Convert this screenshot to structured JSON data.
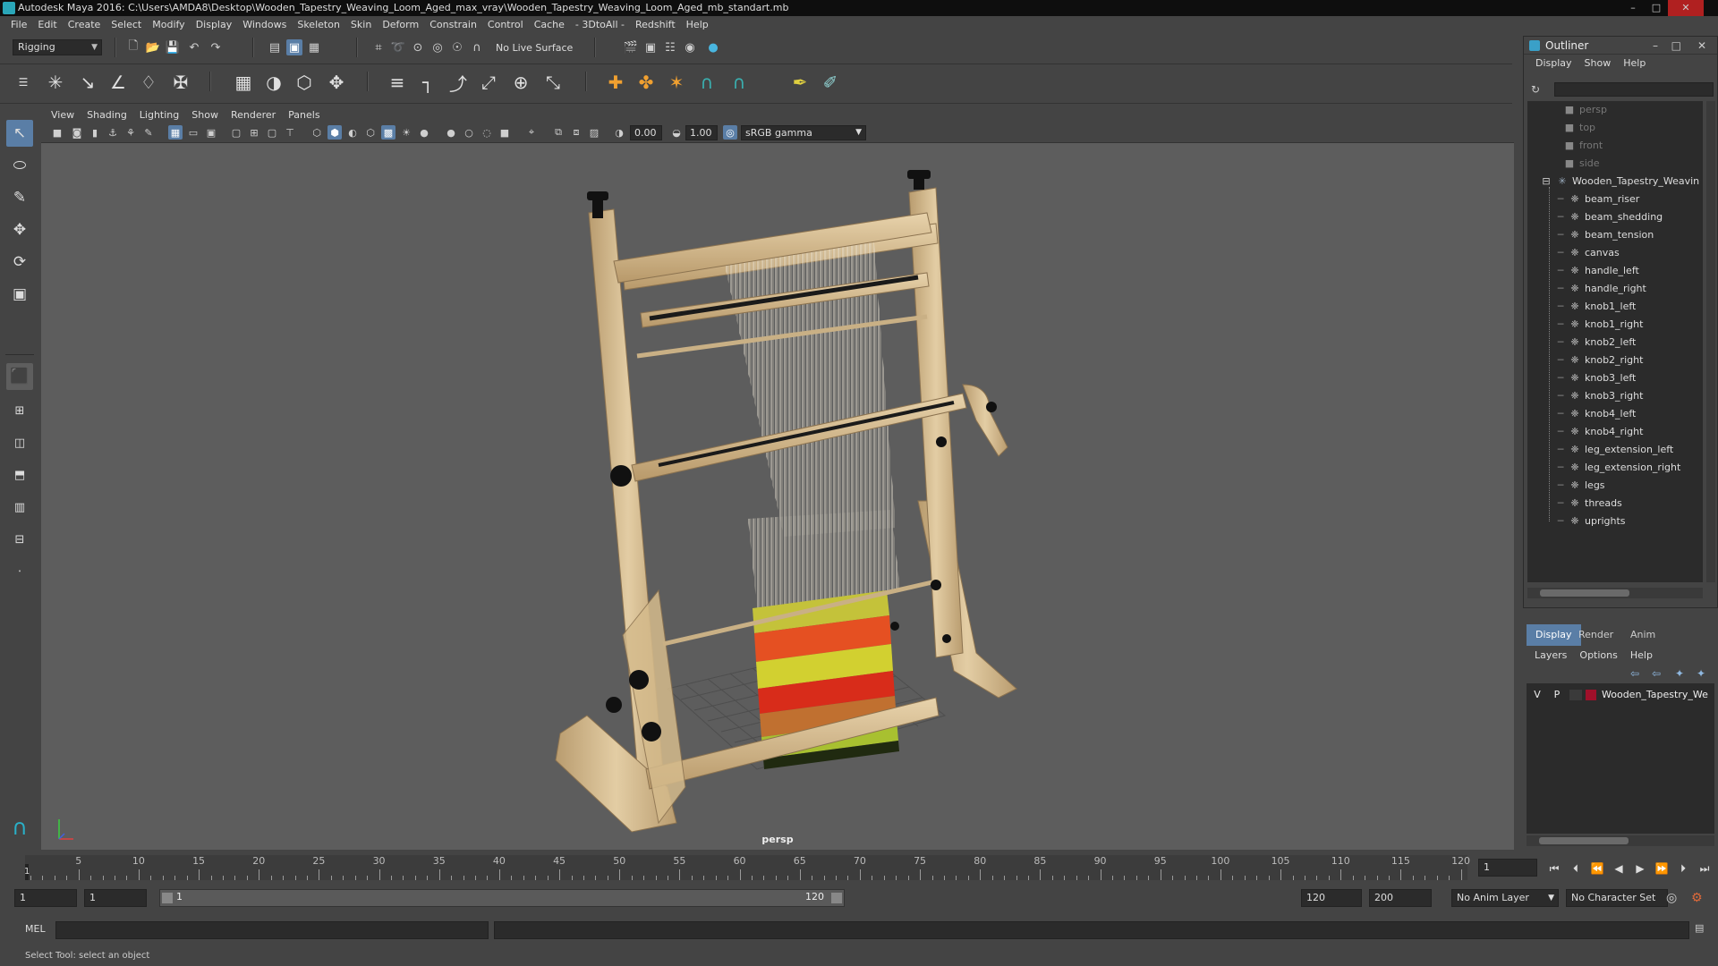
{
  "window": {
    "title": "Autodesk Maya 2016: C:\\Users\\AMDA8\\Desktop\\Wooden_Tapestry_Weaving_Loom_Aged_max_vray\\Wooden_Tapestry_Weaving_Loom_Aged_mb_standart.mb"
  },
  "menubar": [
    "File",
    "Edit",
    "Create",
    "Select",
    "Modify",
    "Display",
    "Windows",
    "Skeleton",
    "Skin",
    "Deform",
    "Constrain",
    "Control",
    "Cache",
    "- 3DtoAll -",
    "Redshift",
    "Help"
  ],
  "statusline": {
    "menuset": "Rigging",
    "live_surface": "No Live Surface"
  },
  "viewport": {
    "menu": [
      "View",
      "Shading",
      "Lighting",
      "Show",
      "Renderer",
      "Panels"
    ],
    "near_value": "0.00",
    "far_value": "1.00",
    "color_space": "sRGB gamma",
    "camera_label": "persp"
  },
  "outliner": {
    "title": "Outliner",
    "menu": [
      "Display",
      "Show",
      "Help"
    ],
    "cameras": [
      "persp",
      "top",
      "front",
      "side"
    ],
    "group": "Wooden_Tapestry_Weavin",
    "children": [
      "beam_riser",
      "beam_shedding",
      "beam_tension",
      "canvas",
      "handle_left",
      "handle_right",
      "knob1_left",
      "knob1_right",
      "knob2_left",
      "knob2_right",
      "knob3_left",
      "knob3_right",
      "knob4_left",
      "knob4_right",
      "leg_extension_left",
      "leg_extension_right",
      "legs",
      "threads",
      "uprights"
    ]
  },
  "layer_editor": {
    "tabs": [
      "Display",
      "Render",
      "Anim"
    ],
    "active_tab": "Display",
    "menu": [
      "Layers",
      "Options",
      "Help"
    ],
    "layer": {
      "v": "V",
      "p": "P",
      "name": "Wooden_Tapestry_We",
      "color": "#a0102a"
    }
  },
  "timeline": {
    "ticks": [
      "5",
      "10",
      "15",
      "20",
      "25",
      "30",
      "35",
      "40",
      "45",
      "50",
      "55",
      "60",
      "65",
      "70",
      "75",
      "80",
      "85",
      "90",
      "95",
      "100",
      "105",
      "110",
      "115",
      "120"
    ],
    "start_marker": "1",
    "current_frame": "1"
  },
  "range": {
    "start": "1",
    "playback_start": "1",
    "slider_start": "1",
    "slider_end": "120",
    "playback_end": "120",
    "end": "200",
    "anim_layer": "No Anim Layer",
    "character_set": "No Character Set"
  },
  "command": {
    "label": "MEL"
  },
  "help_line": "Select Tool: select an object",
  "colors": {
    "accent": "#5a7ea6",
    "viewport_bg": "#5d5d5d",
    "wood": "#d8bf94"
  }
}
